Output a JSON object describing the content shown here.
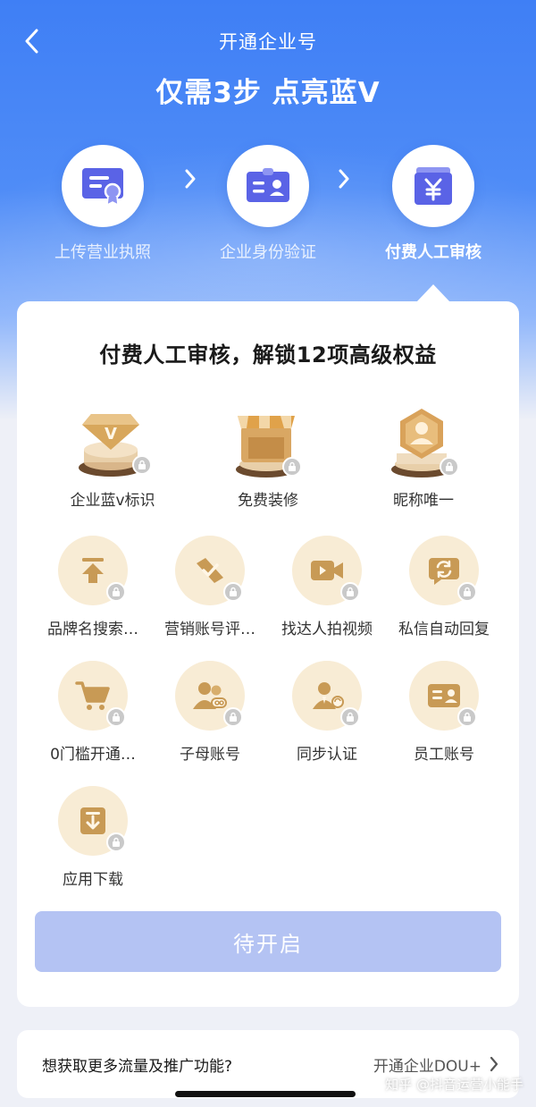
{
  "header": {
    "title": "开通企业号",
    "headline": "仅需3步 点亮蓝V"
  },
  "steps": [
    {
      "label": "上传营业执照",
      "icon": "certificate-icon"
    },
    {
      "label": "企业身份验证",
      "icon": "id-card-icon"
    },
    {
      "label": "付费人工审核",
      "icon": "yen-card-icon"
    }
  ],
  "card": {
    "title": "付费人工审核，解锁12项高级权益",
    "top_features": [
      {
        "label": "企业蓝v标识",
        "icon": "blue-v-badge-icon"
      },
      {
        "label": "免费装修",
        "icon": "storefront-icon"
      },
      {
        "label": "昵称唯一",
        "icon": "unique-avatar-icon"
      }
    ],
    "features": [
      {
        "label": "品牌名搜索…",
        "icon": "upload-arrow-icon"
      },
      {
        "label": "营销账号评…",
        "icon": "ticket-check-icon"
      },
      {
        "label": "找达人拍视频",
        "icon": "video-camera-icon"
      },
      {
        "label": "私信自动回复",
        "icon": "auto-reply-icon"
      },
      {
        "label": "0门槛开通…",
        "icon": "shopping-cart-icon"
      },
      {
        "label": "子母账号",
        "icon": "sub-account-icon"
      },
      {
        "label": "同步认证",
        "icon": "sync-verify-icon"
      },
      {
        "label": "员工账号",
        "icon": "employee-card-icon"
      },
      {
        "label": "应用下载",
        "icon": "download-icon"
      }
    ],
    "cta_label": "待开启"
  },
  "promo": {
    "question": "想获取更多流量及推广功能?",
    "link_label": "开通企业DOU+"
  },
  "watermark": "知乎 @抖音运营小能手",
  "colors": {
    "brand_blue": "#3f7ff5",
    "icon_blue": "#5a63e6",
    "cta_disabled": "#b4c3f3",
    "gold": "#c89a55",
    "gold_bg": "#f8ecd5",
    "lock_gray": "#c9c9c9"
  }
}
